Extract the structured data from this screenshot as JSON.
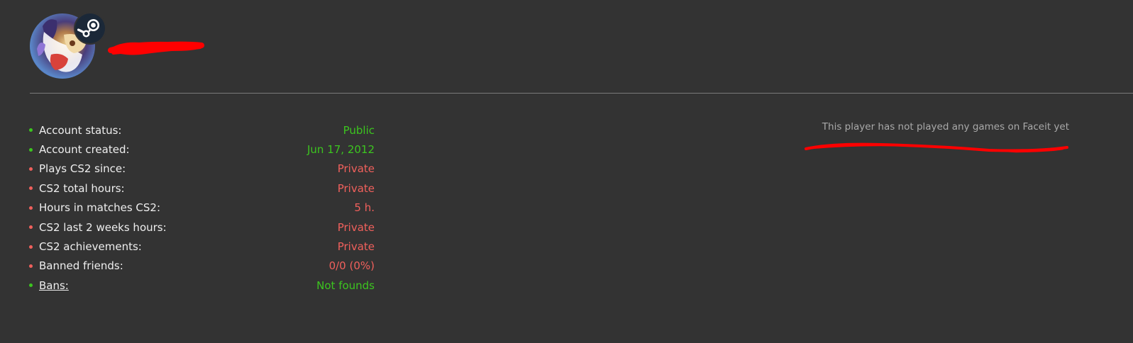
{
  "profile": {
    "avatar_icon": "user-avatar",
    "platform_icon": "steam-icon",
    "name_redaction_color": "#ff0000"
  },
  "stats": [
    {
      "label": "Account status:",
      "value": "Public",
      "status": "good",
      "label_underlined": false
    },
    {
      "label": "Account created:",
      "value": "Jun 17, 2012",
      "status": "good",
      "label_underlined": false
    },
    {
      "label": "Plays CS2 since:",
      "value": "Private",
      "status": "bad",
      "label_underlined": false
    },
    {
      "label": "CS2 total hours:",
      "value": "Private",
      "status": "bad",
      "label_underlined": false
    },
    {
      "label": "Hours in matches CS2:",
      "value": "5 h.",
      "status": "bad",
      "label_underlined": false
    },
    {
      "label": "CS2 last 2 weeks hours:",
      "value": "Private",
      "status": "bad",
      "label_underlined": false
    },
    {
      "label": "CS2 achievements:",
      "value": "Private",
      "status": "bad",
      "label_underlined": false
    },
    {
      "label": "Banned friends:",
      "value": "0/0 (0%)",
      "status": "bad",
      "label_underlined": false
    },
    {
      "label": "Bans:",
      "value": "Not founds",
      "status": "good",
      "label_underlined": true
    }
  ],
  "faceit": {
    "message": "This player has not played any games on Faceit yet"
  },
  "colors": {
    "background": "#333333",
    "good": "#3cc51f",
    "bad": "#f0605c",
    "annotation": "#ff0000",
    "muted_text": "#a9a9a9"
  }
}
